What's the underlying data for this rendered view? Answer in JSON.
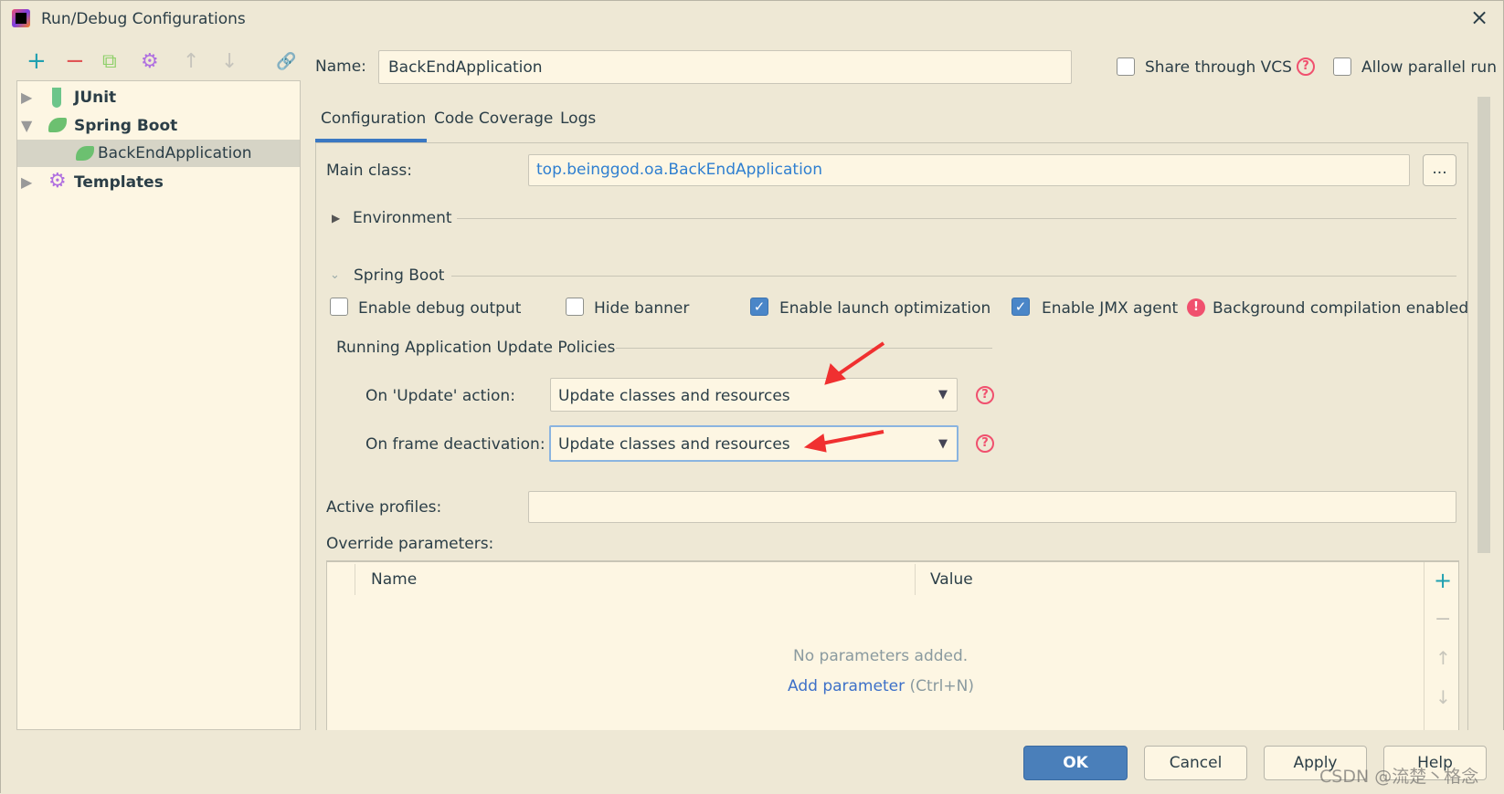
{
  "window": {
    "title": "Run/Debug Configurations",
    "close": "×"
  },
  "toolbar": {
    "add": "+",
    "remove": "−",
    "copy": "⧉",
    "settings": "⚙",
    "up": "↑",
    "down": "↓",
    "link": "🔗"
  },
  "tree": {
    "items": [
      {
        "label": "JUnit",
        "expanded": false
      },
      {
        "label": "Spring Boot",
        "expanded": true
      },
      {
        "label": "BackEndApplication",
        "selected": true
      },
      {
        "label": "Templates",
        "expanded": false
      }
    ]
  },
  "name": {
    "label": "Name:",
    "value": "BackEndApplication"
  },
  "share_vcs": {
    "label": "Share through VCS",
    "checked": false
  },
  "allow_parallel": {
    "label": "Allow parallel run",
    "checked": false
  },
  "tabs": [
    {
      "label": "Configuration",
      "active": true
    },
    {
      "label": "Code Coverage"
    },
    {
      "label": "Logs"
    }
  ],
  "main_class": {
    "label": "Main class:",
    "value": "top.beinggod.oa.BackEndApplication",
    "browse": "..."
  },
  "environment": {
    "label": "Environment"
  },
  "spring_boot": {
    "label": "Spring Boot",
    "options": [
      {
        "label": "Enable debug output",
        "checked": false
      },
      {
        "label": "Hide banner",
        "checked": false
      },
      {
        "label": "Enable launch optimization",
        "checked": true
      },
      {
        "label": "Enable JMX agent",
        "checked": true
      }
    ],
    "warning": "Background compilation enabled"
  },
  "policies": {
    "title": "Running Application Update Policies",
    "update": {
      "label": "On 'Update' action:",
      "value": "Update classes and resources"
    },
    "frame": {
      "label": "On frame deactivation:",
      "value": "Update classes and resources"
    }
  },
  "active_profiles": {
    "label": "Active profiles:",
    "value": ""
  },
  "override": {
    "label": "Override parameters:",
    "columns": [
      "Name",
      "Value"
    ],
    "empty": "No parameters added.",
    "add_link": "Add parameter",
    "shortcut": "(Ctrl+N)"
  },
  "buttons": {
    "ok": "OK",
    "cancel": "Cancel",
    "apply": "Apply",
    "help": "Help"
  },
  "watermark": "CSDN @流楚丶格念",
  "colors": {
    "accent": "#4a86c8",
    "help": "#f0506e",
    "link": "#2f7fd0",
    "annotation_arrow": "#f03030"
  }
}
